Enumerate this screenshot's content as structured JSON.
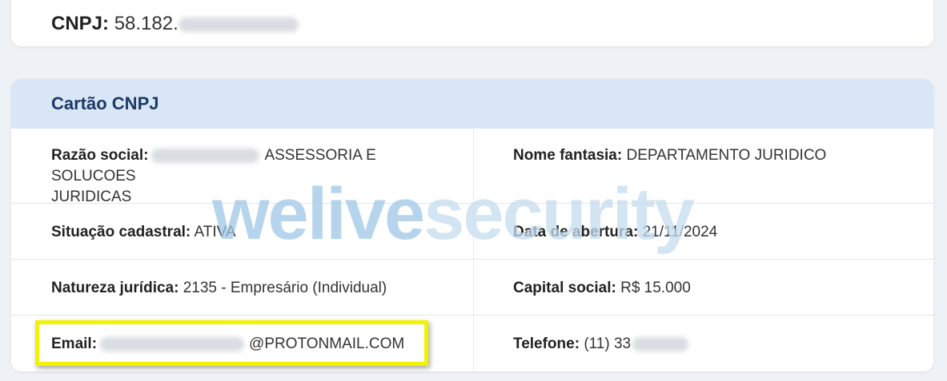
{
  "top_card": {
    "cnpj_label": "CNPJ:",
    "cnpj_value": "58.182."
  },
  "cartao": {
    "title": "Cartão CNPJ",
    "razao_social_label": "Razão social:",
    "razao_social_value": "ASSESSORIA E SOLUCOES",
    "razao_social_value_line2": "JURIDICAS",
    "nome_fantasia_label": "Nome fantasia:",
    "nome_fantasia_value": "DEPARTAMENTO JURIDICO",
    "situacao_label": "Situação cadastral:",
    "situacao_value": "ATIVA",
    "abertura_label": "Data de abertura:",
    "abertura_value": "21/11/2024",
    "natureza_label": "Natureza jurídica:",
    "natureza_value": "2135 - Empresário (Individual)",
    "capital_label": "Capital social:",
    "capital_value": "R$ 15.000",
    "email_label": "Email:",
    "email_value": "@PROTONMAIL.COM",
    "telefone_label": "Telefone:",
    "telefone_value": "(11) 33"
  },
  "watermark": {
    "part1": "welive",
    "part2": "security"
  },
  "colors": {
    "header_bg": "#d8e6f6",
    "title": "#1c3a66",
    "highlight": "#f3f300"
  }
}
